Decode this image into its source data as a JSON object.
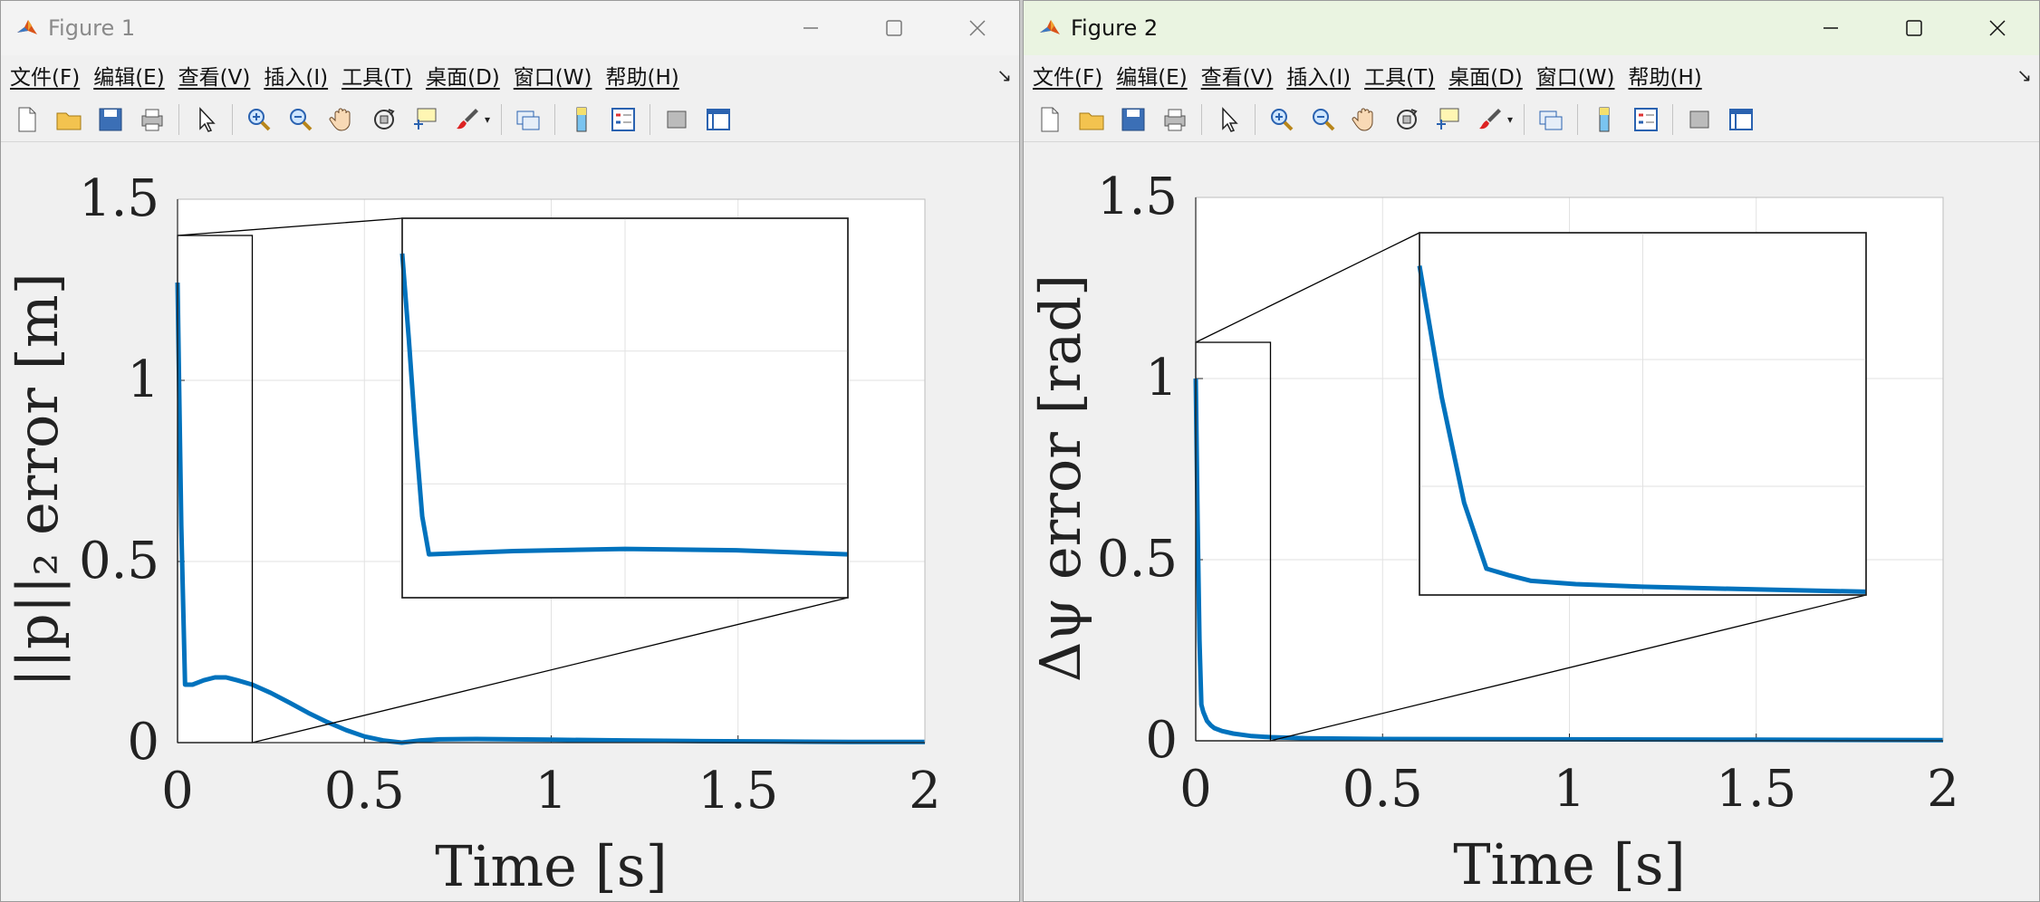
{
  "menus": [
    "文件(F)",
    "编辑(E)",
    "查看(V)",
    "插入(I)",
    "工具(T)",
    "桌面(D)",
    "窗口(W)",
    "帮助(H)"
  ],
  "toolbar_icons": [
    "new-file-icon",
    "open-folder-icon",
    "save-icon",
    "print-icon",
    "pointer-icon",
    "zoom-in-icon",
    "zoom-out-icon",
    "pan-hand-icon",
    "rotate-3d-icon",
    "data-tip-icon",
    "brush-icon",
    "link-plot-icon",
    "colorbar-icon",
    "legend-icon",
    "hide-plot-tools-icon",
    "show-plot-tools-icon"
  ],
  "colors": {
    "line": "#0072BD",
    "axes": "#262626",
    "grid": "#e2e2e2"
  },
  "windows": [
    {
      "title": "Figure 1",
      "active": false,
      "chart_data": {
        "type": "line",
        "xlabel": "Time [s]",
        "ylabel": "||p||₂ error [m]",
        "xlim": [
          0,
          2
        ],
        "ylim": [
          0,
          1.5
        ],
        "xticks": [
          "0",
          "0.5",
          "1",
          "1.5",
          "2"
        ],
        "yticks": [
          "0",
          "0.5",
          "1",
          "1.5"
        ],
        "grid": true,
        "series": [
          {
            "x": [
              0,
              0.01,
              0.02,
              0.04,
              0.07,
              0.1,
              0.13,
              0.16,
              0.2,
              0.25,
              0.3,
              0.35,
              0.4,
              0.45,
              0.5,
              0.55,
              0.6,
              0.65,
              0.7,
              0.8,
              0.9,
              1.0,
              1.2,
              1.4,
              1.6,
              1.8,
              2.0
            ],
            "y": [
              1.27,
              0.6,
              0.16,
              0.16,
              0.172,
              0.18,
              0.18,
              0.172,
              0.16,
              0.137,
              0.11,
              0.082,
              0.057,
              0.035,
              0.017,
              0.006,
              0.0,
              0.006,
              0.009,
              0.01,
              0.009,
              0.008,
              0.006,
              0.004,
              0.003,
              0.002,
              0.002
            ]
          }
        ],
        "inset": {
          "xlim": [
            0,
            0.2
          ],
          "ylim": [
            0,
            1.4
          ],
          "x": [
            0,
            0.003,
            0.006,
            0.009,
            0.012,
            0.05,
            0.1,
            0.15,
            0.2
          ],
          "y": [
            1.27,
            0.95,
            0.6,
            0.3,
            0.16,
            0.172,
            0.18,
            0.175,
            0.16
          ]
        }
      }
    },
    {
      "title": "Figure 2",
      "active": true,
      "chart_data": {
        "type": "line",
        "xlabel": "Time [s]",
        "ylabel": "Δψ error [rad]",
        "xlim": [
          0,
          2
        ],
        "ylim": [
          0,
          1.5
        ],
        "xticks": [
          "0",
          "0.5",
          "1",
          "1.5",
          "2"
        ],
        "yticks": [
          "0",
          "0.5",
          "1",
          "1.5"
        ],
        "grid": true,
        "series": [
          {
            "x": [
              0,
              0.005,
              0.01,
              0.015,
              0.02,
              0.03,
              0.04,
              0.05,
              0.07,
              0.1,
              0.15,
              0.2,
              0.3,
              0.5,
              1.0,
              1.5,
              2.0
            ],
            "y": [
              1.0,
              0.6,
              0.28,
              0.1,
              0.08,
              0.055,
              0.043,
              0.035,
              0.027,
              0.02,
              0.013,
              0.01,
              0.007,
              0.005,
              0.004,
              0.003,
              0.002
            ]
          }
        ],
        "inset": {
          "xlim": [
            0,
            0.2
          ],
          "ylim": [
            0,
            1.1
          ],
          "x": [
            0,
            0.01,
            0.02,
            0.03,
            0.04,
            0.05,
            0.07,
            0.1,
            0.15,
            0.2
          ],
          "y": [
            1.0,
            0.6,
            0.28,
            0.08,
            0.06,
            0.043,
            0.033,
            0.025,
            0.017,
            0.01
          ]
        }
      }
    }
  ]
}
